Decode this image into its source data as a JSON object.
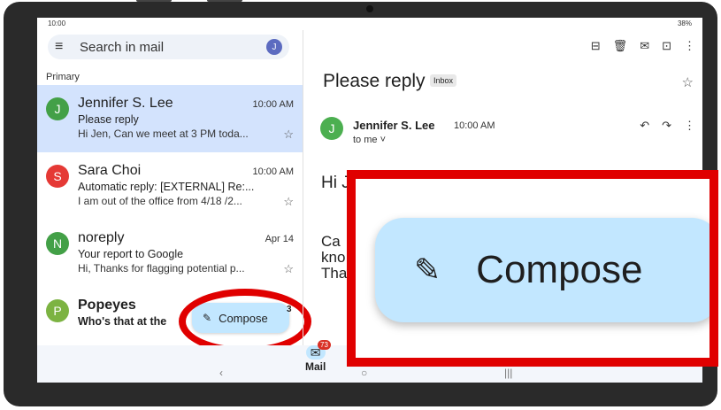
{
  "status": {
    "time": "10:00",
    "battery": "38%"
  },
  "search": {
    "placeholder": "Search in mail",
    "avatar_letter": "J"
  },
  "section": "Primary",
  "emails": [
    {
      "avatar": "J",
      "color": "#43a047",
      "sender": "Jennifer S. Lee",
      "time": "10:00 AM",
      "subject": "Please reply",
      "snippet": "Hi Jen, Can we meet at 3 PM toda...",
      "selected": true,
      "bold": false
    },
    {
      "avatar": "S",
      "color": "#e53935",
      "sender": "Sara Choi",
      "time": "10:00 AM",
      "subject": "Automatic reply: [EXTERNAL] Re:...",
      "snippet": "I am out of the office from 4/18 /2...",
      "selected": false,
      "bold": false
    },
    {
      "avatar": "N",
      "color": "#43a047",
      "sender": "noreply",
      "time": "Apr 14",
      "subject": "Your report to Google",
      "snippet": "Hi, Thanks for flagging potential p...",
      "selected": false,
      "bold": false
    },
    {
      "avatar": "P",
      "color": "#7cb342",
      "sender": "Popeyes",
      "time": "",
      "subject": "Who's that at the",
      "snippet": "",
      "selected": false,
      "bold": true
    }
  ],
  "compose": {
    "label": "Compose",
    "count": "3"
  },
  "reader": {
    "subject": "Please reply",
    "chip": "Inbox",
    "from_avatar": "J",
    "from_name": "Jennifer S. Lee",
    "from_time": "10:00 AM",
    "to": "to me ˅",
    "greeting": "Hi Jen,",
    "body": "Ca kno Tha"
  },
  "nav": {
    "mail_label": "Mail",
    "mail_badge": "73"
  },
  "icons": [
    "menu-icon",
    "archive-icon",
    "delete-icon",
    "mark-unread-icon",
    "move-icon",
    "more-icon",
    "star-icon",
    "reply-icon",
    "forward-icon",
    "pencil-icon",
    "mail-icon"
  ]
}
